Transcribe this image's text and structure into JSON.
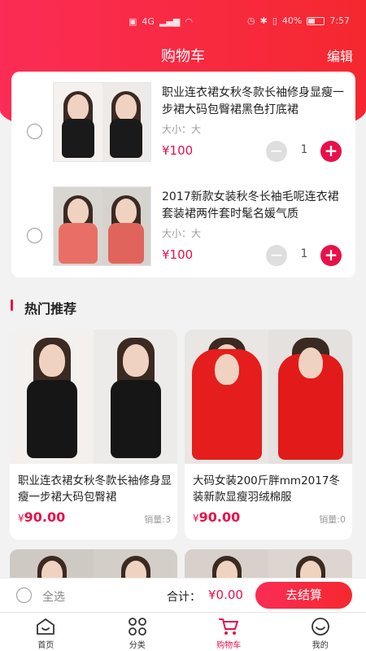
{
  "status_bar": {
    "battery": "40%",
    "time": "7:57",
    "signal": "4G"
  },
  "header": {
    "title": "购物车",
    "edit_label": "编辑"
  },
  "cart": {
    "items": [
      {
        "title": "职业连衣裙女秋冬款长袖修身显瘦一步裙大码包臀裙黑色打底裙",
        "spec": "大小：大",
        "price": "¥100",
        "quantity": "1",
        "selected": false
      },
      {
        "title": "2017新款女装秋冬长袖毛呢连衣裙套装裙两件套时髦名媛气质",
        "spec": "大小：大",
        "price": "¥100",
        "quantity": "1",
        "selected": false
      }
    ]
  },
  "recommend": {
    "section_title": "热门推荐",
    "items": [
      {
        "title": "职业连衣裙女秋冬款长袖修身显瘦一步裙大码包臀裙",
        "currency": "¥",
        "price": "90.00",
        "sales": "销量:3"
      },
      {
        "title": "大码女装200斤胖mm2017冬装新款显瘦羽绒棉服",
        "currency": "¥",
        "price": "90.00",
        "sales": "销量:0"
      }
    ]
  },
  "checkout": {
    "select_all_label": "全选",
    "total_label": "合计：",
    "total_amount": "¥0.00",
    "pay_label": "去结算"
  },
  "tabbar": {
    "tabs": [
      {
        "label": "首页",
        "icon": "home-icon"
      },
      {
        "label": "分类",
        "icon": "category-icon"
      },
      {
        "label": "购物车",
        "icon": "cart-icon",
        "active": true
      },
      {
        "label": "我的",
        "icon": "profile-icon"
      }
    ]
  },
  "colors": {
    "accent": "#e8104a",
    "header_gradient_start": "#fb2c55",
    "header_gradient_end": "#f5282f"
  }
}
